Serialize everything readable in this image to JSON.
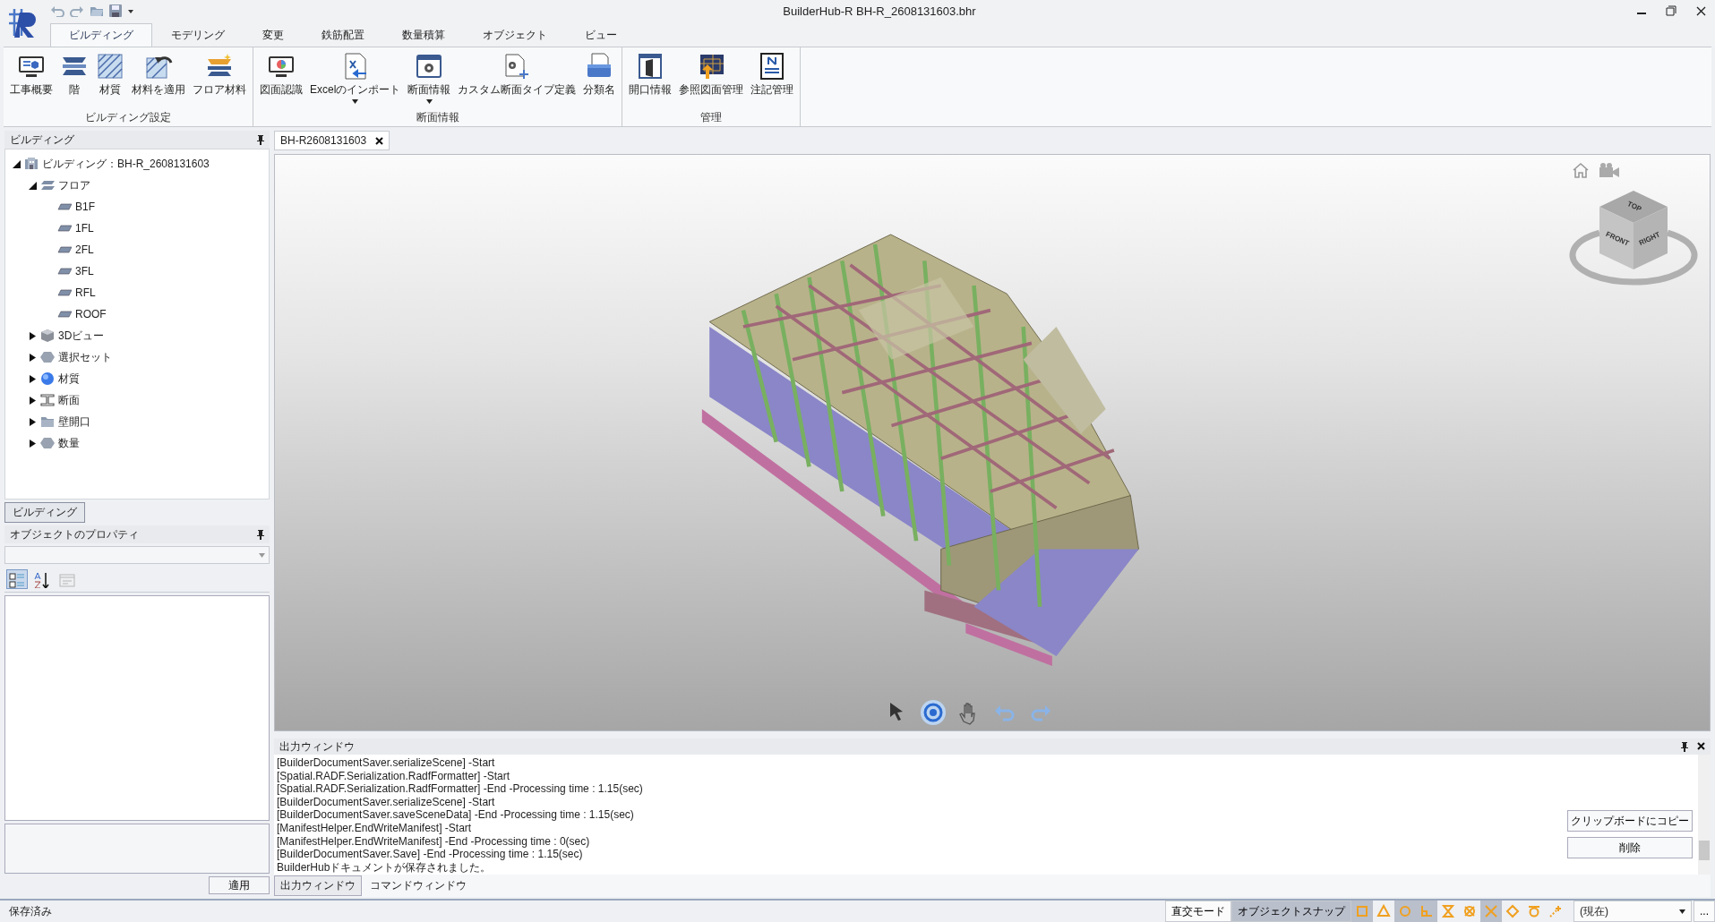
{
  "window": {
    "title": "BuilderHub-R BH-R_2608131603.bhr"
  },
  "ribbon_tabs": [
    {
      "label": "ビルディング",
      "selected": true
    },
    {
      "label": "モデリング",
      "selected": false
    },
    {
      "label": "変更",
      "selected": false
    },
    {
      "label": "鉄筋配置",
      "selected": false
    },
    {
      "label": "数量積算",
      "selected": false
    },
    {
      "label": "オブジェクト",
      "selected": false
    },
    {
      "label": "ビュー",
      "selected": false
    }
  ],
  "ribbon_groups": [
    {
      "title": "ビルディング設定",
      "buttons": [
        {
          "label": "工事概要",
          "dropdown": false
        },
        {
          "label": "階",
          "dropdown": false
        },
        {
          "label": "材質",
          "dropdown": false
        },
        {
          "label": "材料を適用",
          "dropdown": false
        },
        {
          "label": "フロア材料",
          "dropdown": false
        }
      ]
    },
    {
      "title": "断面情報",
      "buttons": [
        {
          "label": "図面認識",
          "dropdown": false
        },
        {
          "label": "Excelのインポート",
          "dropdown": true
        },
        {
          "label": "断面情報",
          "dropdown": true
        },
        {
          "label": "カスタム断面タイプ定義",
          "dropdown": false
        },
        {
          "label": "分類名",
          "dropdown": false
        }
      ]
    },
    {
      "title": "管理",
      "buttons": [
        {
          "label": "開口情報",
          "dropdown": false
        },
        {
          "label": "参照図面管理",
          "dropdown": false
        },
        {
          "label": "注記管理",
          "dropdown": false
        }
      ]
    }
  ],
  "building_panel": {
    "title": "ビルディング",
    "tree": [
      {
        "label": "ビルディング：BH-R_2608131603",
        "expanded": true,
        "children": [
          {
            "label": "フロア",
            "expanded": true,
            "children": [
              {
                "label": "B1F"
              },
              {
                "label": "1FL"
              },
              {
                "label": "2FL"
              },
              {
                "label": "3FL"
              },
              {
                "label": "RFL"
              },
              {
                "label": "ROOF"
              }
            ]
          },
          {
            "label": "3Dビュー",
            "expanded": false
          },
          {
            "label": "選択セット",
            "expanded": false
          },
          {
            "label": "材質",
            "expanded": false
          },
          {
            "label": "断面",
            "expanded": false
          },
          {
            "label": "壁開口",
            "expanded": false
          },
          {
            "label": "数量",
            "expanded": false
          }
        ]
      }
    ]
  },
  "panel_tabs": [
    {
      "label": "ビルディング",
      "selected": true
    }
  ],
  "properties_panel": {
    "title": "オブジェクトのプロパティ",
    "tools": [
      {
        "selected": true,
        "disabled": false
      },
      {
        "selected": false,
        "disabled": false
      },
      {
        "selected": false,
        "disabled": true
      }
    ],
    "apply_button": "適用"
  },
  "document_tabs": [
    {
      "label": "BH-R2608131603",
      "selected": true
    }
  ],
  "viewport": {
    "nav_cube": {
      "top": "TOP",
      "front": "FRONT",
      "right": "RIGHT"
    },
    "nav_tools": [
      {
        "selected": false
      },
      {
        "selected": true
      },
      {
        "selected": false
      },
      {
        "selected": false
      },
      {
        "selected": false
      }
    ]
  },
  "output_window": {
    "title": "出力ウィンドウ",
    "lines": [
      "[BuilderDocumentSaver.serializeScene] -Start",
      "[Spatial.RADF.Serialization.RadfFormatter] -Start",
      "[Spatial.RADF.Serialization.RadfFormatter] -End -Processing time : 1.15(sec)",
      "[BuilderDocumentSaver.serializeScene] -Start",
      "[BuilderDocumentSaver.saveSceneData] -End -Processing time : 1.15(sec)",
      "[ManifestHelper.EndWriteManifest] -Start",
      "[ManifestHelper.EndWriteManifest] -End -Processing time : 0(sec)",
      "[BuilderDocumentSaver.Save] -End -Processing time : 1.15(sec)",
      "BuilderHubドキュメントが保存されました。"
    ],
    "buttons": [
      "クリップボードにコピー",
      "削除"
    ],
    "tabs": [
      {
        "label": "出力ウィンドウ",
        "selected": true
      },
      {
        "label": "コマンドウィンドウ",
        "selected": false
      }
    ]
  },
  "status_bar": {
    "message": "保存済み",
    "modes": [
      {
        "label": "直交モード",
        "on": false
      },
      {
        "label": "オブジェクトスナップ",
        "on": true
      }
    ],
    "snaps": [
      {
        "on": true
      },
      {
        "on": false
      },
      {
        "on": true
      },
      {
        "on": true
      },
      {
        "on": false
      },
      {
        "on": false
      },
      {
        "on": true
      },
      {
        "on": false
      },
      {
        "on": false
      },
      {
        "on": false
      }
    ],
    "view_select": "(現在)",
    "more": "..."
  }
}
